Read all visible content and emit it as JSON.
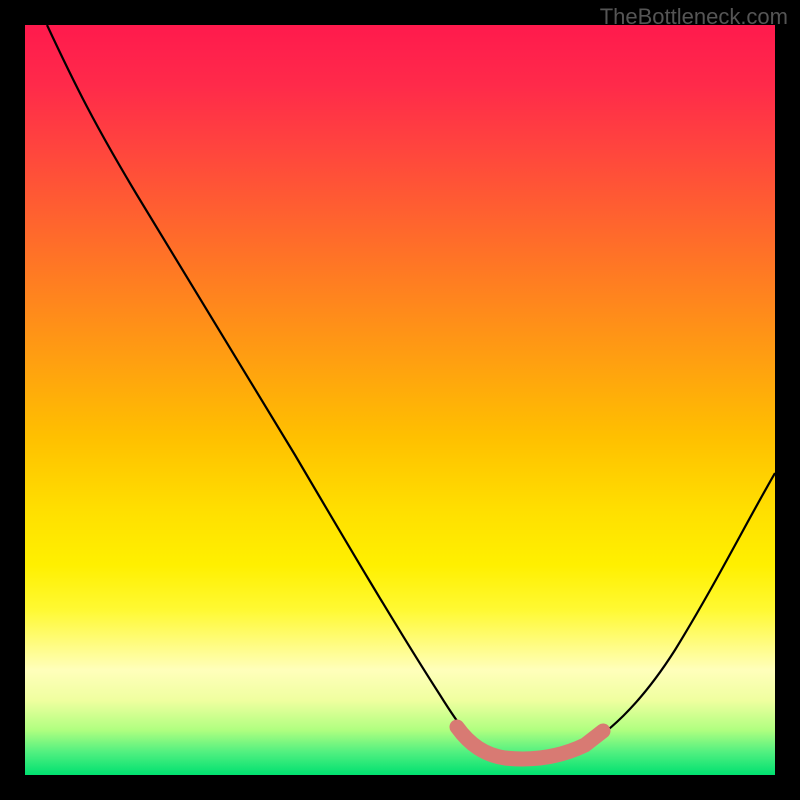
{
  "watermark": "TheBottleneck.com",
  "chart_data": {
    "type": "line",
    "title": "",
    "xlabel": "",
    "ylabel": "",
    "xlim": [
      0,
      100
    ],
    "ylim": [
      0,
      100
    ],
    "series": [
      {
        "name": "bottleneck-curve",
        "x": [
          3,
          10,
          20,
          30,
          40,
          48,
          55,
          58,
          62,
          66,
          70,
          75,
          80,
          86,
          92,
          97,
          100
        ],
        "values": [
          100,
          89,
          75,
          61,
          47,
          35,
          22,
          14,
          7,
          3,
          2,
          2.5,
          6,
          14,
          26,
          38,
          46
        ]
      },
      {
        "name": "optimal-range-marker",
        "x": [
          58,
          62,
          66,
          70,
          74,
          77
        ],
        "values": [
          6,
          3.5,
          2.5,
          2.5,
          4,
          7
        ]
      }
    ],
    "annotations": [],
    "background_gradient": {
      "top": "#ff1a4d",
      "mid": "#ffe000",
      "bottom": "#00e070"
    }
  }
}
